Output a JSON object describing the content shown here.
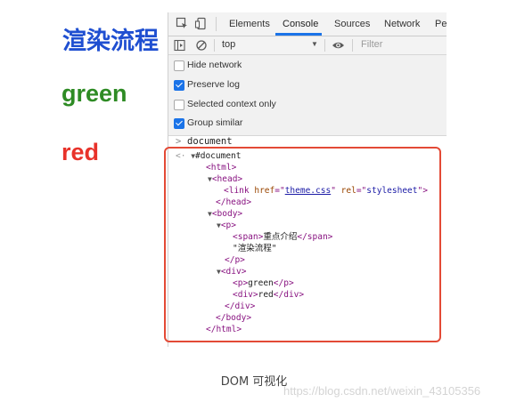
{
  "page": {
    "title": "渲染流程",
    "line_green": "green",
    "line_red": "red"
  },
  "devtools": {
    "tabs": [
      "Elements",
      "Console",
      "Sources",
      "Network",
      "Pe"
    ],
    "active_tab": "Console",
    "context_select": "top",
    "filter_placeholder": "Filter",
    "settings": [
      {
        "label": "Hide network",
        "checked": false
      },
      {
        "label": "Preserve log",
        "checked": true
      },
      {
        "label": "Selected context only",
        "checked": false
      },
      {
        "label": "Group similar",
        "checked": true
      }
    ],
    "console_input": "document"
  },
  "dom_tree": {
    "root": "#document",
    "html_open": "<html>",
    "head_open": "<head>",
    "link_tag": "link",
    "link_href_attr": "href",
    "link_href_value": "theme.css",
    "link_rel_attr": "rel",
    "link_rel_value": "stylesheet",
    "head_close": "</head>",
    "body_open": "<body>",
    "p_open": "<p>",
    "span_open": "<span>",
    "span_text": "重点介绍",
    "span_close": "</span>",
    "p_text": "\"渲染流程\"",
    "p_close": "</p>",
    "div_open": "<div>",
    "inner_p_open": "<p>",
    "inner_p_text": "green",
    "inner_p_close": "</p>",
    "inner_div_open": "<div>",
    "inner_div_text": "red",
    "inner_div_close": "</div>",
    "div_close": "</div>",
    "body_close": "</body>",
    "html_close": "</html>"
  },
  "caption": "DOM 可视化",
  "watermark": "https://blog.csdn.net/weixin_43105356",
  "colors": {
    "title_blue": "#1f4fd1",
    "green_text": "#2e8b24",
    "red_text": "#e8322a",
    "highlight_border": "#e34a36",
    "checkbox_blue": "#1a73e8"
  }
}
